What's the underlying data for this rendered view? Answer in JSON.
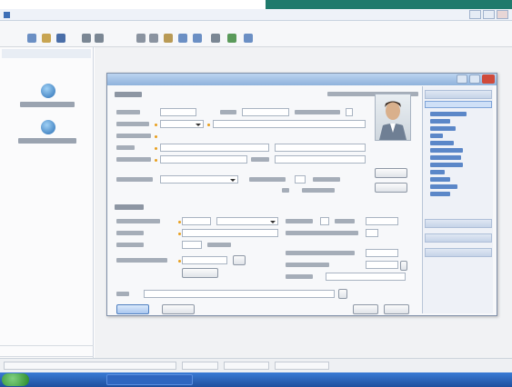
{
  "window": {
    "title": ""
  },
  "menu": {
    "items": [
      "",
      "",
      "",
      "",
      "",
      "",
      ""
    ]
  },
  "navigation": {
    "header": "",
    "items": [
      {
        "label": "",
        "icon": "user-icon"
      },
      {
        "label": "",
        "icon": "user-group-icon"
      }
    ],
    "footer_items": [
      "",
      ""
    ]
  },
  "dialog": {
    "title": "",
    "photo_label": "",
    "sections": {
      "identity": "",
      "employment": ""
    },
    "fields": {},
    "buttons": {
      "ok": "",
      "cancel": "",
      "prev": "",
      "next": ""
    }
  },
  "right_panel": {
    "groups": [
      {
        "title": "",
        "links": [
          "",
          "",
          "",
          "",
          "",
          "",
          "",
          "",
          "",
          "",
          "",
          "",
          "",
          "",
          ""
        ]
      },
      {
        "title": "",
        "links": []
      },
      {
        "title": "",
        "links": []
      },
      {
        "title": "",
        "links": []
      }
    ]
  },
  "statusbar": {
    "cells": [
      "",
      "",
      "",
      ""
    ]
  },
  "taskbar": {
    "active_window": "",
    "clock": ""
  },
  "colors": {
    "accent": "#1f7a6c",
    "title_blue": "#8fb2dc",
    "required": "#e8a020",
    "taskbar": "#1f4f9e"
  }
}
